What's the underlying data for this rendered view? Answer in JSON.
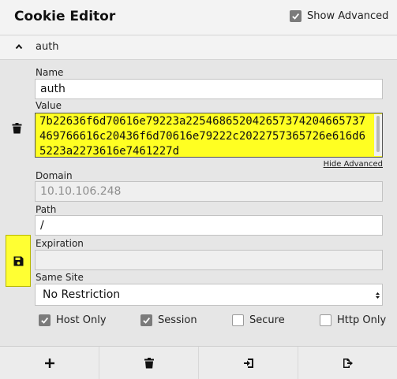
{
  "header": {
    "title": "Cookie Editor",
    "show_advanced_label": "Show Advanced",
    "show_advanced_checked": true
  },
  "cookie": {
    "name": "auth",
    "fields": {
      "name_label": "Name",
      "name_value": "auth",
      "value_label": "Value",
      "value_text": "7b22636f6d70616e79223a225468652042657374204665737469766616c20436f6d70616e79222c2022757365726e616d65223a2273616e7461227d",
      "hide_advanced": "Hide Advanced",
      "domain_label": "Domain",
      "domain_value": "10.10.106.248",
      "path_label": "Path",
      "path_value": "/",
      "expiration_label": "Expiration",
      "expiration_value": "",
      "same_site_label": "Same Site",
      "same_site_value": "No Restriction"
    },
    "flags": [
      {
        "label": "Host Only",
        "checked": true
      },
      {
        "label": "Session",
        "checked": true
      },
      {
        "label": "Secure",
        "checked": false
      },
      {
        "label": "Http Only",
        "checked": false
      }
    ]
  },
  "icons": {
    "collapse": "chevron-up-icon",
    "delete_cookie": "trash-icon",
    "save_cookie": "floppy-disk-icon",
    "footer": [
      "plus-icon",
      "trash-icon",
      "import-icon",
      "export-icon"
    ]
  },
  "colors": {
    "highlight": "#ffff22",
    "save_button": "#ffff33"
  }
}
